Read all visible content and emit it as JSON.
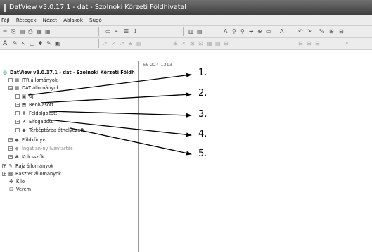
{
  "window": {
    "title": "DatView v3.0.17.1 - dat - Szolnoki Körzeti Földhivatal"
  },
  "menu": {
    "items": [
      "Fájl",
      "Rétegek",
      "Nézet",
      "Ablakok",
      "Súgó"
    ]
  },
  "toolbar1": {
    "left_icons": [
      "✂",
      "⎘",
      "▤",
      "⎙",
      "▦",
      "▦"
    ],
    "mid_icons": [
      "▭",
      "⌖",
      "☰",
      "↕"
    ],
    "right_icons": [
      "▥",
      "▤",
      "A",
      "⚲",
      "⚲",
      "➔",
      "⊕",
      "▭",
      "A",
      "↶",
      "↷",
      "%",
      "⊞",
      "⊟"
    ]
  },
  "toolbar2": {
    "icons": [
      "A",
      "✎",
      "↖",
      "▢",
      "✱",
      "✎",
      "▣"
    ],
    "greyed": [
      "↗",
      "↗",
      "↗",
      "⊕",
      "▤",
      "⊞",
      "✕",
      "⊠",
      "⊡",
      "▦",
      "▤",
      "⊟",
      "⊟",
      "⊟",
      "⊟",
      "✕"
    ]
  },
  "status": {
    "coordinate": "66-224-1313"
  },
  "tree": {
    "root": "DatView v3.0.17.1 - dat - Szolnoki Körzeti Földh",
    "items": [
      {
        "label": "ITR állományok"
      },
      {
        "label": "DAT állományok"
      },
      {
        "label": "Új"
      },
      {
        "label": "Beolvasott"
      },
      {
        "label": "Feldolgozott"
      },
      {
        "label": "Elfogadott"
      },
      {
        "label": "Térképtárba áthelyezett"
      },
      {
        "label": "Földkönyv"
      },
      {
        "label": "Ingatlan-nyilvántartás"
      },
      {
        "label": "Kulcsszók"
      },
      {
        "label": "Rajz állományok"
      },
      {
        "label": "Raszter állományok"
      },
      {
        "label": "Kilo"
      },
      {
        "label": "Verem"
      }
    ]
  },
  "callouts": [
    "1.",
    "2.",
    "3.",
    "4.",
    "5."
  ],
  "colors": {
    "titlebar": "#4a4a4a",
    "chrome": "#ececec"
  }
}
